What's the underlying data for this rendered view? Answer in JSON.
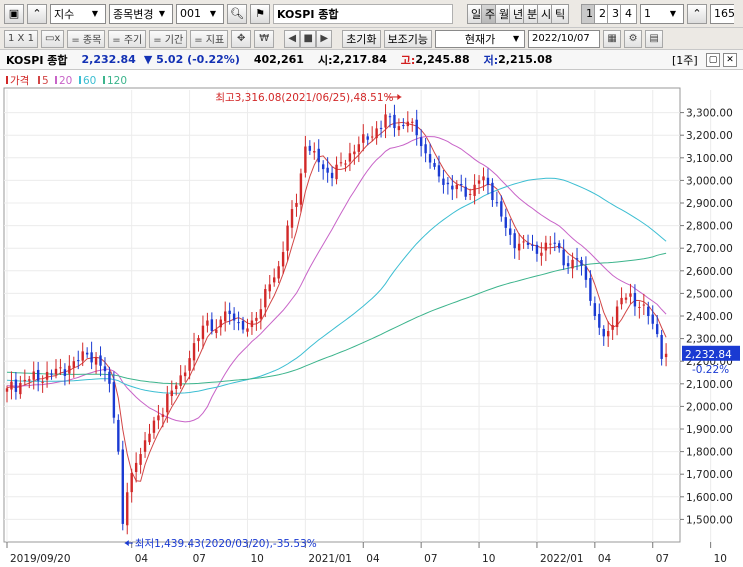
{
  "toolbar1": {
    "market_select": "지수",
    "change_label": "종목변경",
    "code_value": "001",
    "name_value": "KOSPI 종합",
    "periods": [
      {
        "label": "일",
        "active": false
      },
      {
        "label": "주",
        "active": true
      },
      {
        "label": "월",
        "active": false
      },
      {
        "label": "년",
        "active": false
      },
      {
        "label": "분",
        "active": false
      },
      {
        "label": "시",
        "active": false
      },
      {
        "label": "틱",
        "active": false
      }
    ],
    "multipliers": [
      {
        "label": "1",
        "active": true
      },
      {
        "label": "2",
        "active": false
      },
      {
        "label": "3",
        "active": false
      },
      {
        "label": "4",
        "active": false
      }
    ],
    "multiplier_value": "1",
    "count_value": "165"
  },
  "toolbar2": {
    "layout_label": "1 X 1",
    "item_label": "= 종목",
    "cycle_label": "= 주기",
    "period_label": "= 기간",
    "indicator_label": "= 지표",
    "currency_icon_text": "₩",
    "reset_label": "초기화",
    "aux_label": "보조기능",
    "price_select": "현재가",
    "date_value": "2022/10/07"
  },
  "infobar": {
    "name": "KOSPI 종합",
    "price": "2,232.84",
    "change": "▼ 5.02 (-0.22%)",
    "volume": "402,261",
    "open_label": "시:",
    "open": "2,217.84",
    "high_label": "고:",
    "high": "2,245.88",
    "low_label": "저:",
    "low": "2,215.08",
    "panel_label": "[1주]"
  },
  "colors": {
    "up": "#d22828",
    "down": "#1a3ad2",
    "ma5": "#d24646",
    "ma20": "#c864c8",
    "ma60": "#3cbed2",
    "ma120": "#3cb48c",
    "price_tag": "#1a3ad2"
  },
  "chart_data": {
    "type": "candlestick",
    "timeframe": "weekly",
    "legend": [
      {
        "label": "가격",
        "color": "#d22828"
      },
      {
        "label": "5",
        "color": "#d24646"
      },
      {
        "label": "20",
        "color": "#c864c8"
      },
      {
        "label": "60",
        "color": "#3cbed2"
      },
      {
        "label": "120",
        "color": "#3cb48c"
      }
    ],
    "ylim": [
      1400,
      3400
    ],
    "y_ticks": [
      1500,
      1600,
      1700,
      1800,
      1900,
      2000,
      2100,
      2200,
      2300,
      2400,
      2500,
      2600,
      2700,
      2800,
      2900,
      3000,
      3100,
      3200,
      3300
    ],
    "x_labels": [
      "2019/09/20",
      "04",
      "07",
      "10",
      "2021/01",
      "04",
      "07",
      "10",
      "2022/01",
      "04",
      "07",
      "10"
    ],
    "x_label_weeks": [
      0,
      28,
      41,
      54,
      67,
      80,
      93,
      106,
      119,
      132,
      145,
      158
    ],
    "anchors": [
      [
        0,
        2080
      ],
      [
        5,
        2120
      ],
      [
        10,
        2140
      ],
      [
        14,
        2180
      ],
      [
        18,
        2230
      ],
      [
        21,
        2180
      ],
      [
        23,
        2100
      ],
      [
        24,
        1950
      ],
      [
        25,
        1800
      ],
      [
        26,
        1480
      ],
      [
        27,
        1620
      ],
      [
        29,
        1750
      ],
      [
        31,
        1850
      ],
      [
        34,
        1960
      ],
      [
        37,
        2070
      ],
      [
        40,
        2150
      ],
      [
        42,
        2280
      ],
      [
        45,
        2380
      ],
      [
        47,
        2340
      ],
      [
        49,
        2420
      ],
      [
        51,
        2380
      ],
      [
        53,
        2340
      ],
      [
        55,
        2380
      ],
      [
        57,
        2430
      ],
      [
        59,
        2540
      ],
      [
        61,
        2620
      ],
      [
        63,
        2800
      ],
      [
        65,
        2900
      ],
      [
        67,
        3150
      ],
      [
        69,
        3130
      ],
      [
        71,
        3050
      ],
      [
        73,
        3010
      ],
      [
        75,
        3080
      ],
      [
        77,
        3120
      ],
      [
        79,
        3160
      ],
      [
        81,
        3180
      ],
      [
        83,
        3230
      ],
      [
        86,
        3280
      ],
      [
        88,
        3240
      ],
      [
        90,
        3260
      ],
      [
        92,
        3200
      ],
      [
        94,
        3120
      ],
      [
        96,
        3060
      ],
      [
        98,
        2980
      ],
      [
        100,
        2960
      ],
      [
        102,
        2980
      ],
      [
        104,
        2940
      ],
      [
        106,
        3000
      ],
      [
        108,
        2980
      ],
      [
        110,
        2900
      ],
      [
        112,
        2790
      ],
      [
        114,
        2700
      ],
      [
        116,
        2730
      ],
      [
        118,
        2710
      ],
      [
        120,
        2680
      ],
      [
        122,
        2720
      ],
      [
        124,
        2700
      ],
      [
        126,
        2620
      ],
      [
        128,
        2650
      ],
      [
        130,
        2560
      ],
      [
        132,
        2400
      ],
      [
        134,
        2310
      ],
      [
        136,
        2360
      ],
      [
        138,
        2480
      ],
      [
        140,
        2500
      ],
      [
        142,
        2440
      ],
      [
        144,
        2400
      ],
      [
        146,
        2320
      ],
      [
        147,
        2210
      ],
      [
        148,
        2232.84
      ]
    ],
    "current_price": "2,232.84",
    "current_change": "-0.22%",
    "annotations": [
      {
        "text": "최고3,316.08(2021/06/25),48.51%",
        "week": 89,
        "value": 3316.08,
        "color": "#d22828"
      },
      {
        "text": "최저1,439.43(2020/03/20),-35.53%",
        "week": 26,
        "value": 1439.43,
        "color": "#1a3ad2"
      }
    ]
  }
}
